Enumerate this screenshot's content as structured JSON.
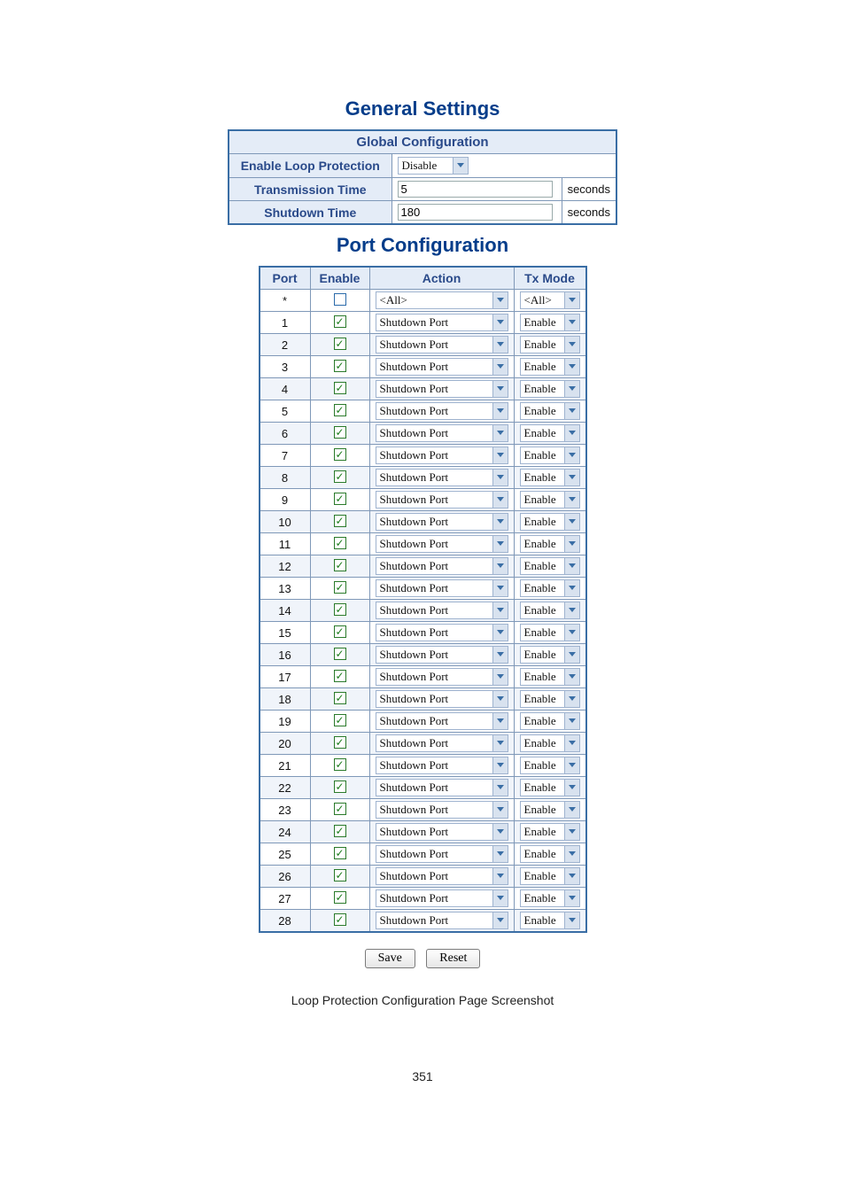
{
  "header": {
    "general_title": "General Settings",
    "port_title": "Port Configuration"
  },
  "global": {
    "section_title": "Global Configuration",
    "enable_label": "Enable Loop Protection",
    "enable_value": "Disable",
    "tx_time_label": "Transmission Time",
    "tx_time_value": "5",
    "tx_time_unit": "seconds",
    "shut_time_label": "Shutdown Time",
    "shut_time_value": "180",
    "shut_time_unit": "seconds"
  },
  "port_headers": {
    "port": "Port",
    "enable": "Enable",
    "action": "Action",
    "txmode": "Tx Mode"
  },
  "all_row": {
    "port": "*",
    "action": "<All>",
    "txmode": "<All>"
  },
  "ports": [
    {
      "port": "1",
      "enable": true,
      "action": "Shutdown Port",
      "txmode": "Enable"
    },
    {
      "port": "2",
      "enable": true,
      "action": "Shutdown Port",
      "txmode": "Enable"
    },
    {
      "port": "3",
      "enable": true,
      "action": "Shutdown Port",
      "txmode": "Enable"
    },
    {
      "port": "4",
      "enable": true,
      "action": "Shutdown Port",
      "txmode": "Enable"
    },
    {
      "port": "5",
      "enable": true,
      "action": "Shutdown Port",
      "txmode": "Enable"
    },
    {
      "port": "6",
      "enable": true,
      "action": "Shutdown Port",
      "txmode": "Enable"
    },
    {
      "port": "7",
      "enable": true,
      "action": "Shutdown Port",
      "txmode": "Enable"
    },
    {
      "port": "8",
      "enable": true,
      "action": "Shutdown Port",
      "txmode": "Enable"
    },
    {
      "port": "9",
      "enable": true,
      "action": "Shutdown Port",
      "txmode": "Enable"
    },
    {
      "port": "10",
      "enable": true,
      "action": "Shutdown Port",
      "txmode": "Enable"
    },
    {
      "port": "11",
      "enable": true,
      "action": "Shutdown Port",
      "txmode": "Enable"
    },
    {
      "port": "12",
      "enable": true,
      "action": "Shutdown Port",
      "txmode": "Enable"
    },
    {
      "port": "13",
      "enable": true,
      "action": "Shutdown Port",
      "txmode": "Enable"
    },
    {
      "port": "14",
      "enable": true,
      "action": "Shutdown Port",
      "txmode": "Enable"
    },
    {
      "port": "15",
      "enable": true,
      "action": "Shutdown Port",
      "txmode": "Enable"
    },
    {
      "port": "16",
      "enable": true,
      "action": "Shutdown Port",
      "txmode": "Enable"
    },
    {
      "port": "17",
      "enable": true,
      "action": "Shutdown Port",
      "txmode": "Enable"
    },
    {
      "port": "18",
      "enable": true,
      "action": "Shutdown Port",
      "txmode": "Enable"
    },
    {
      "port": "19",
      "enable": true,
      "action": "Shutdown Port",
      "txmode": "Enable"
    },
    {
      "port": "20",
      "enable": true,
      "action": "Shutdown Port",
      "txmode": "Enable"
    },
    {
      "port": "21",
      "enable": true,
      "action": "Shutdown Port",
      "txmode": "Enable"
    },
    {
      "port": "22",
      "enable": true,
      "action": "Shutdown Port",
      "txmode": "Enable"
    },
    {
      "port": "23",
      "enable": true,
      "action": "Shutdown Port",
      "txmode": "Enable"
    },
    {
      "port": "24",
      "enable": true,
      "action": "Shutdown Port",
      "txmode": "Enable"
    },
    {
      "port": "25",
      "enable": true,
      "action": "Shutdown Port",
      "txmode": "Enable"
    },
    {
      "port": "26",
      "enable": true,
      "action": "Shutdown Port",
      "txmode": "Enable"
    },
    {
      "port": "27",
      "enable": true,
      "action": "Shutdown Port",
      "txmode": "Enable"
    },
    {
      "port": "28",
      "enable": true,
      "action": "Shutdown Port",
      "txmode": "Enable"
    }
  ],
  "buttons": {
    "save": "Save",
    "reset": "Reset"
  },
  "caption": "Loop Protection Configuration Page Screenshot",
  "page_number": "351"
}
